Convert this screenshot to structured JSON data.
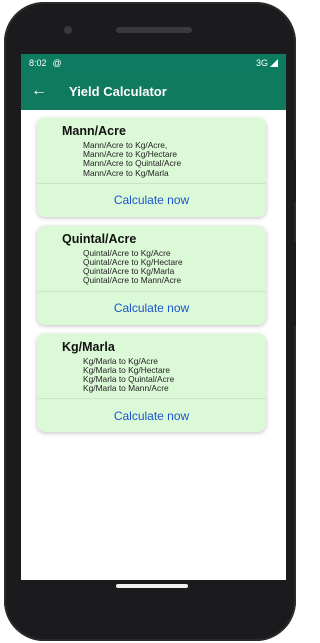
{
  "status": {
    "time": "8:02",
    "network": "3G",
    "notif_icon": "at-sign-icon"
  },
  "app_bar": {
    "title": "Yield Calculator"
  },
  "cards": [
    {
      "title": "Mann/Acre",
      "items": [
        "Mann/Acre to Kg/Acre,",
        "Mann/Acre to Kg/Hectare",
        "Mann/Acre to Quintal/Acre",
        "Mann/Acre to Kg/Marla"
      ],
      "action": "Calculate now"
    },
    {
      "title": "Quintal/Acre",
      "items": [
        "Quintal/Acre to Kg/Acre",
        "Quintal/Acre to Kg/Hectare",
        "Quintal/Acre to Kg/Marla",
        "Quintal/Acre to Mann/Acre"
      ],
      "action": "Calculate now"
    },
    {
      "title": "Kg/Marla",
      "items": [
        "Kg/Marla to Kg/Acre",
        "Kg/Marla to Kg/Hectare",
        "Kg/Marla to Quintal/Acre",
        "Kg/Marla to Mann/Acre"
      ],
      "action": "Calculate now"
    }
  ],
  "colors": {
    "primary": "#0f7a5e",
    "card_bg": "#dcf9d7",
    "action_text": "#1a55d0"
  }
}
